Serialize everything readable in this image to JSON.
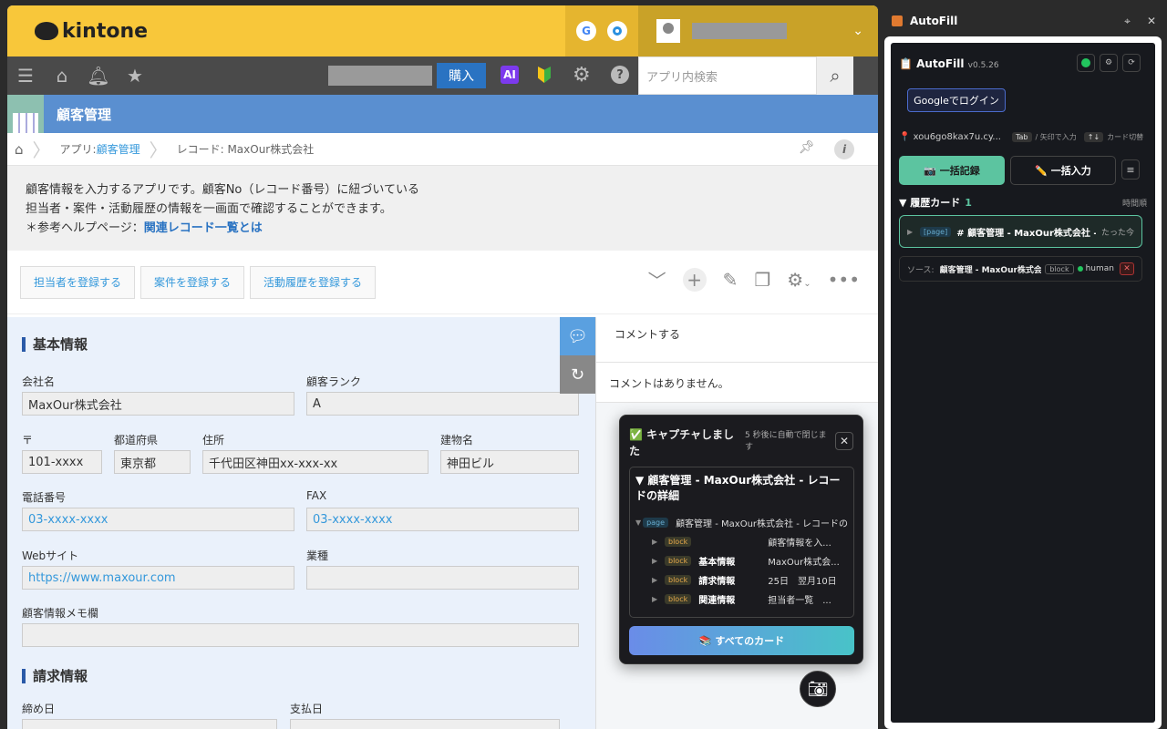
{
  "kintone": {
    "logo": "kintone",
    "buy": "購入",
    "ai": "AI",
    "search_placeholder": "アプリ内検索",
    "app_title": "顧客管理",
    "breadcrumb": {
      "app_prefix": "アプリ: ",
      "app_link": "顧客管理",
      "record": "レコード: MaxOur株式会社"
    },
    "description": {
      "line1": "顧客情報を入力するアプリです。顧客No（レコード番号）に紐づいている",
      "line2": "担当者・案件・活動履歴の情報を一画面で確認することができます。",
      "line3_prefix": "＊参考ヘルプページ：",
      "line3_link": "関連レコード一覧とは"
    },
    "actions": [
      "担当者を登録する",
      "案件を登録する",
      "活動履歴を登録する"
    ],
    "section_basic": "基本情報",
    "section_billing": "請求情報",
    "fields": {
      "company_label": "会社名",
      "company": "MaxOur株式会社",
      "rank_label": "顧客ランク",
      "rank": "A",
      "zip_label": "〒",
      "zip": "101-xxxx",
      "pref_label": "都道府県",
      "pref": "東京都",
      "addr_label": "住所",
      "addr": "千代田区神田xx-xxx-xx",
      "bldg_label": "建物名",
      "bldg": "神田ビル",
      "tel_label": "電話番号",
      "tel": "03-xxxx-xxxx",
      "fax_label": "FAX",
      "fax": "03-xxxx-xxxx",
      "web_label": "Webサイト",
      "web": "https://www.maxour.com",
      "industry_label": "業種",
      "industry": "",
      "memo_label": "顧客情報メモ欄",
      "memo": "",
      "close_label": "締め日",
      "pay_label": "支払日"
    },
    "comment": {
      "prompt": "コメントする",
      "none": "コメントはありません。"
    }
  },
  "toast": {
    "title": "✅ キャプチャしました",
    "sub": "5 秒後に自動で閉じます",
    "close": "✕",
    "tree_title": "▼ 顧客管理 - MaxOur株式会社 - レコードの詳細",
    "page_badge": "page",
    "page_text": "顧客管理 - MaxOur株式会社 - レコードの",
    "rows": [
      {
        "badge": "block",
        "name": "",
        "value": "顧客情報を入..."
      },
      {
        "badge": "block",
        "name": "基本情報",
        "value": "MaxOur株式会..."
      },
      {
        "badge": "block",
        "name": "請求情報",
        "value": "25日　翌月10日"
      },
      {
        "badge": "block",
        "name": "関連情報",
        "value": "担当者一覧　..."
      }
    ],
    "all_cards": "📚 すべてのカード"
  },
  "autofill": {
    "tab_title": "AutoFill",
    "title": "📋 AutoFill",
    "version": "v0.5.26",
    "google_login": "Googleでログイン",
    "url": "📍 xou6go8kax7u.cy...",
    "tab_key": "Tab",
    "tab_hint": "/ 矢印で入力",
    "arrow_key": "↑↓",
    "arrow_hint": "カード切替",
    "record_btn": "📷 一括記録",
    "bulk_btn": "✏️ 一括入力",
    "history_title": "▼ 履歴カード",
    "history_count": "1",
    "order": "時間順",
    "card": {
      "badge": "[page]",
      "title": "# 顧客管理 - MaxOur株式会社 - レコードの詳細",
      "ago": "たった今"
    },
    "source": {
      "label": "ソース:",
      "value": "顧客管理 - MaxOur株式会社",
      "badge": "block",
      "owner": "human",
      "remove": "✕"
    }
  }
}
